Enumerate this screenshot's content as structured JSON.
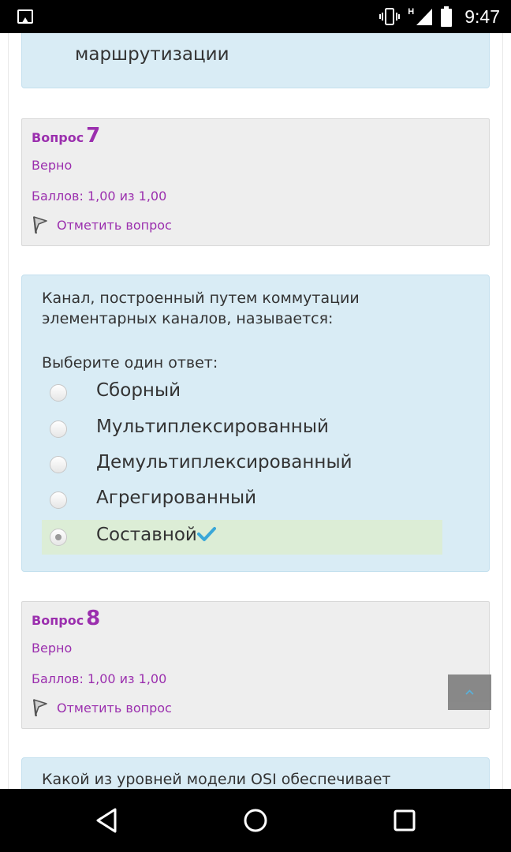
{
  "status_bar": {
    "time": "9:47",
    "network_label": "H",
    "icons": [
      "gallery-icon",
      "vibrate-icon",
      "signal-icon",
      "battery-icon"
    ]
  },
  "previous_question": {
    "text_tail": "маршрутизации"
  },
  "questions": [
    {
      "number_word": "Вопрос",
      "number": "7",
      "state": "Верно",
      "grade": "Баллов: 1,00 из 1,00",
      "flag_label": "Отметить вопрос",
      "text_line1": "Канал, построенный путем коммутации",
      "text_line2": "элементарных каналов, называется:",
      "prompt": "Выберите один ответ:",
      "options": [
        {
          "label": "Сборный",
          "selected": false
        },
        {
          "label": "Мультиплексированный",
          "selected": false
        },
        {
          "label": "Демультиплексированный",
          "selected": false
        },
        {
          "label": "Агрегированный",
          "selected": false
        },
        {
          "label": "Составной",
          "selected": true,
          "correct": true
        }
      ]
    },
    {
      "number_word": "Вопрос",
      "number": "8",
      "state": "Верно",
      "grade": "Баллов: 1,00 из 1,00",
      "flag_label": "Отметить вопрос",
      "text_line1": "Какой из уровней модели OSI обеспечивает"
    }
  ],
  "colors": {
    "accent_purple": "#9b2fae",
    "answer_bg": "#d9ecf5",
    "info_bg": "#eeeeee",
    "correct_bg": "#dcedd6",
    "check_blue": "#3aa7d8"
  },
  "nav_bar": {
    "buttons": [
      "back-icon",
      "home-icon",
      "recents-icon"
    ]
  }
}
